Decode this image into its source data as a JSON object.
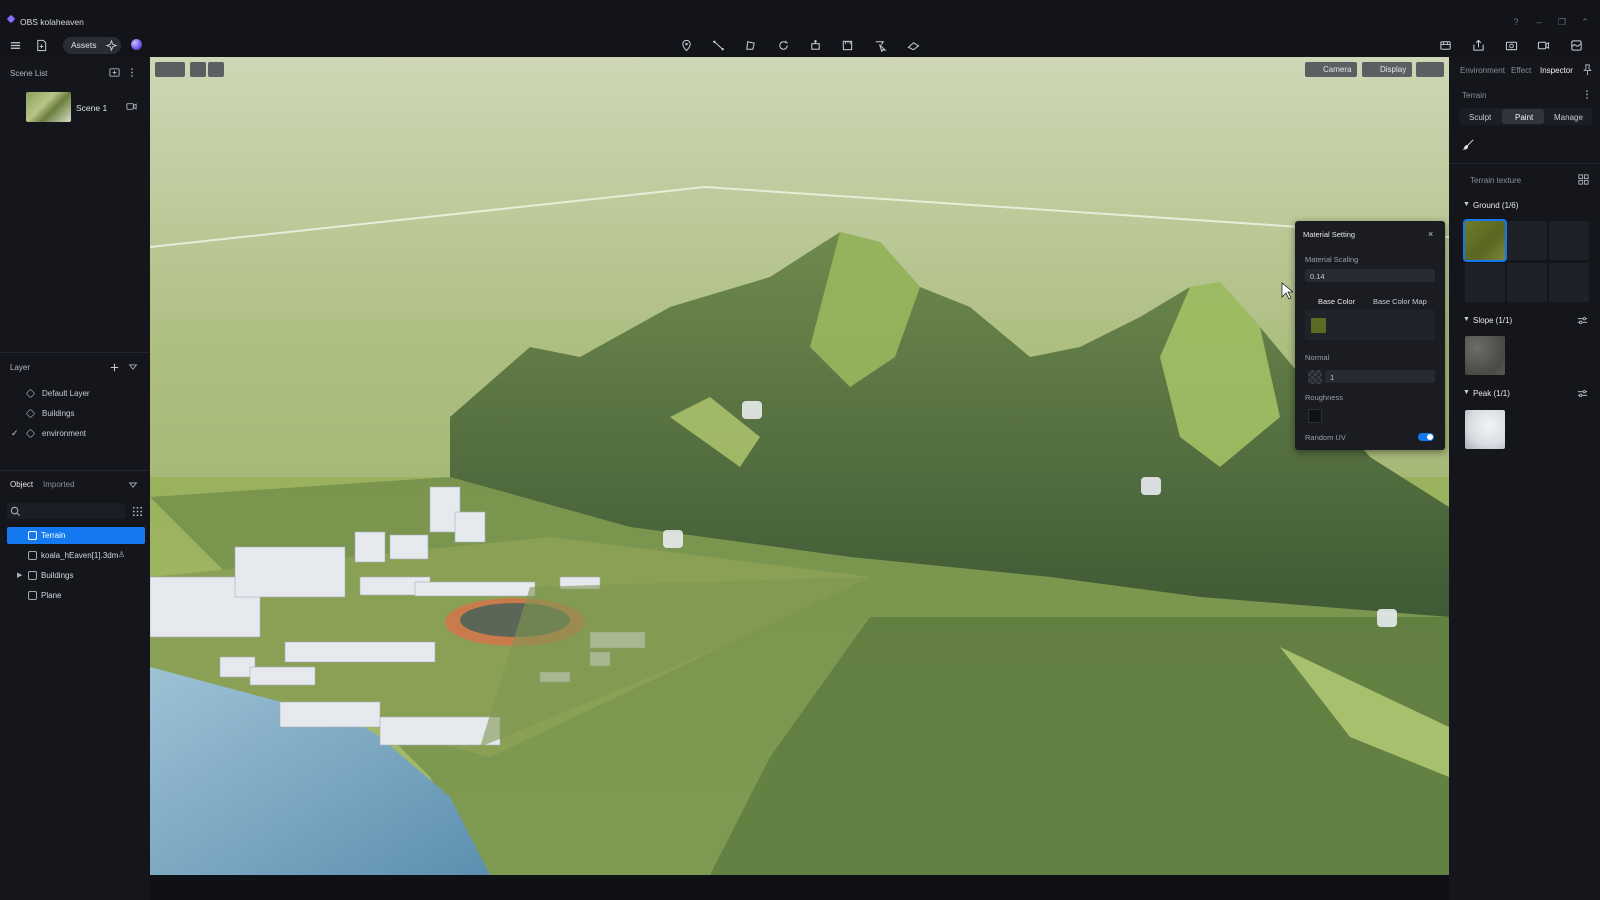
{
  "app": {
    "title": "OBS kolaheaven"
  },
  "toolbar": {
    "assets_label": "Assets"
  },
  "scene_list": {
    "title": "Scene List",
    "scenes": [
      {
        "name": "Scene 1"
      }
    ]
  },
  "layer": {
    "title": "Layer",
    "items": [
      {
        "label": "Default Layer",
        "checked": false
      },
      {
        "label": "Buildings",
        "checked": false
      },
      {
        "label": "environment",
        "checked": true
      }
    ]
  },
  "object_panel": {
    "tabs": [
      {
        "label": "Object"
      },
      {
        "label": "Imported"
      }
    ],
    "items": [
      {
        "label": "Terrain",
        "selected": true
      },
      {
        "label": "koala_hEaven[1].3dm",
        "selected": false
      },
      {
        "label": "Buildings",
        "selected": false,
        "expandable": true
      },
      {
        "label": "Plane",
        "selected": false
      }
    ]
  },
  "viewport": {
    "camera_label": "Camera",
    "display_label": "Display"
  },
  "material_setting": {
    "title": "Material Setting",
    "scaling_label": "Material Scaling",
    "scaling_value": "0.14",
    "base_color_tab": "Base Color",
    "base_color_map_tab": "Base Color Map",
    "base_color_swatch": "#5c6a23",
    "normal_label": "Normal",
    "normal_value": "1",
    "roughness_label": "Roughness",
    "random_uv_label": "Random UV",
    "random_uv_enabled": true
  },
  "inspector": {
    "tabs": [
      {
        "label": "Environment"
      },
      {
        "label": "Effect"
      },
      {
        "label": "Inspector",
        "active": true
      }
    ],
    "section_title": "Terrain",
    "mode_tabs": [
      {
        "label": "Sculpt"
      },
      {
        "label": "Paint",
        "active": true
      },
      {
        "label": "Manage"
      }
    ],
    "texture_title": "Terrain texture",
    "groups": [
      {
        "label": "Ground (1/6)"
      },
      {
        "label": "Slope (1/1)"
      },
      {
        "label": "Peak (1/1)"
      }
    ]
  },
  "colors": {
    "accent": "#1479f0",
    "panel": "#14161c",
    "background": "#0f1116"
  }
}
